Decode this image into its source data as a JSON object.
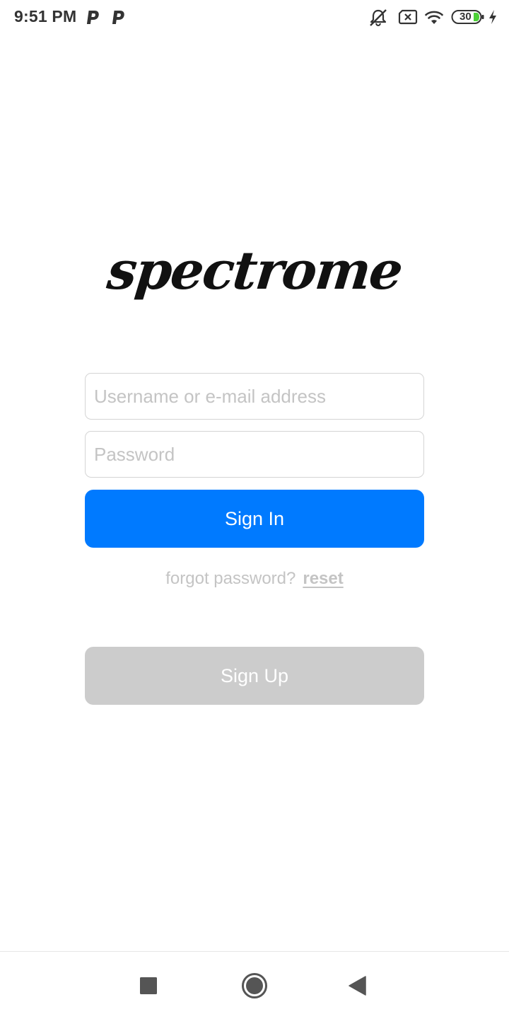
{
  "status_bar": {
    "time": "9:51 PM",
    "battery_level": "30"
  },
  "icons": {
    "left_status": [
      "parking-icon",
      "parking-icon"
    ],
    "right_status": [
      "bell-muted-icon",
      "sim-error-icon",
      "wifi-icon",
      "battery-icon",
      "charging-bolt-icon"
    ],
    "nav": [
      "recents-square-icon",
      "home-circle-icon",
      "back-triangle-icon"
    ]
  },
  "logo": {
    "text": "spectrome"
  },
  "login": {
    "username_placeholder": "Username or e-mail address",
    "password_placeholder": "Password",
    "sign_in_label": "Sign In",
    "forgot_text": "forgot password?",
    "reset_link": "reset",
    "sign_up_label": "Sign Up"
  },
  "colors": {
    "primary": "#007aff",
    "secondary_button": "#cccccc",
    "muted_text": "#c4c4c4",
    "input_border": "#d4d4d4",
    "battery_green": "#4cd137"
  }
}
